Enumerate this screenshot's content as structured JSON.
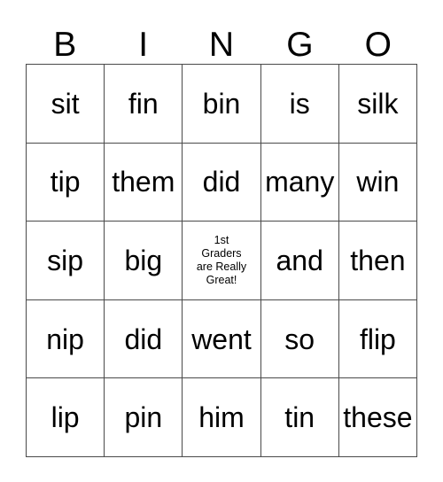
{
  "card": {
    "header_letters": [
      "B",
      "I",
      "N",
      "G",
      "O"
    ],
    "columns": 5,
    "rows": 5,
    "border_color": "#4a4a4a",
    "background_color": "#ffffff",
    "text_color": "#000000",
    "cells": [
      {
        "row": 1,
        "col": 1,
        "text": "sit",
        "free": false
      },
      {
        "row": 1,
        "col": 2,
        "text": "fin",
        "free": false
      },
      {
        "row": 1,
        "col": 3,
        "text": "bin",
        "free": false
      },
      {
        "row": 1,
        "col": 4,
        "text": "is",
        "free": false
      },
      {
        "row": 1,
        "col": 5,
        "text": "silk",
        "free": false
      },
      {
        "row": 2,
        "col": 1,
        "text": "tip",
        "free": false
      },
      {
        "row": 2,
        "col": 2,
        "text": "them",
        "free": false
      },
      {
        "row": 2,
        "col": 3,
        "text": "did",
        "free": false
      },
      {
        "row": 2,
        "col": 4,
        "text": "many",
        "free": false
      },
      {
        "row": 2,
        "col": 5,
        "text": "win",
        "free": false
      },
      {
        "row": 3,
        "col": 1,
        "text": "sip",
        "free": false
      },
      {
        "row": 3,
        "col": 2,
        "text": "big",
        "free": false
      },
      {
        "row": 3,
        "col": 3,
        "text": "1st Graders are Really Great!",
        "free": true,
        "lines": [
          "1st",
          "Graders",
          "are Really",
          "Great!"
        ]
      },
      {
        "row": 3,
        "col": 4,
        "text": "and",
        "free": false
      },
      {
        "row": 3,
        "col": 5,
        "text": "then",
        "free": false
      },
      {
        "row": 4,
        "col": 1,
        "text": "nip",
        "free": false
      },
      {
        "row": 4,
        "col": 2,
        "text": "did",
        "free": false
      },
      {
        "row": 4,
        "col": 3,
        "text": "went",
        "free": false
      },
      {
        "row": 4,
        "col": 4,
        "text": "so",
        "free": false
      },
      {
        "row": 4,
        "col": 5,
        "text": "flip",
        "free": false
      },
      {
        "row": 5,
        "col": 1,
        "text": "lip",
        "free": false
      },
      {
        "row": 5,
        "col": 2,
        "text": "pin",
        "free": false
      },
      {
        "row": 5,
        "col": 3,
        "text": "him",
        "free": false
      },
      {
        "row": 5,
        "col": 4,
        "text": "tin",
        "free": false
      },
      {
        "row": 5,
        "col": 5,
        "text": "these",
        "free": false
      }
    ]
  }
}
